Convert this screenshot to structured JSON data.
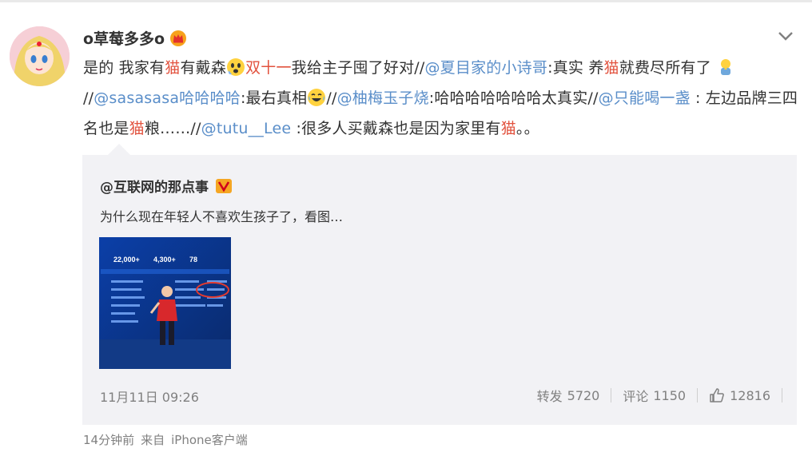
{
  "user": {
    "name": "o草莓多多o"
  },
  "post": {
    "segments": [
      {
        "t": "是的 我家有",
        "s": "text"
      },
      {
        "t": "猫",
        "s": "kw"
      },
      {
        "t": "有戴森",
        "s": "text"
      },
      {
        "t": "emoji-fear",
        "s": "emoji"
      },
      {
        "t": "双十一",
        "s": "kw"
      },
      {
        "t": "我给主子囤了好对//",
        "s": "text"
      },
      {
        "t": "@夏目家的小诗哥",
        "s": "mention"
      },
      {
        "t": ":真实 养",
        "s": "text"
      },
      {
        "t": "猫",
        "s": "kw"
      },
      {
        "t": "就费尽所有了 ",
        "s": "text"
      },
      {
        "t": "emoji-pray",
        "s": "emoji"
      },
      {
        "t": " //",
        "s": "text"
      },
      {
        "t": "@sasasasa哈哈哈哈",
        "s": "mention"
      },
      {
        "t": ":最右真相",
        "s": "text"
      },
      {
        "t": "emoji-laughcry",
        "s": "emoji"
      },
      {
        "t": "//",
        "s": "text"
      },
      {
        "t": "@柚梅玉子烧",
        "s": "mention"
      },
      {
        "t": ":哈哈哈哈哈哈哈太真实//",
        "s": "text"
      },
      {
        "t": "@只能喝一盏",
        "s": "mention"
      },
      {
        "t": " : 左边品牌三四名也是",
        "s": "text"
      },
      {
        "t": "猫",
        "s": "kw"
      },
      {
        "t": "粮……//",
        "s": "text"
      },
      {
        "t": "@tutu__Lee",
        "s": "mention"
      },
      {
        "t": " :很多人买戴森也是因为家里有",
        "s": "text"
      },
      {
        "t": "猫",
        "s": "kw"
      },
      {
        "t": "。。",
        "s": "text"
      }
    ],
    "time": "14分钟前",
    "source_prefix": "来自",
    "source": "iPhone客户端"
  },
  "original": {
    "author": "@互联网的那点事",
    "text": "为什么现在年轻人不喜欢生孩子了，看图…",
    "date": "11月11日 09:26",
    "repost_label": "转发",
    "repost_count": "5720",
    "comment_label": "评论",
    "comment_count": "1150",
    "like_count": "12816",
    "image": {
      "stat1": "22,000+",
      "stat2": "4,300+",
      "stat3": "78"
    }
  },
  "colors": {
    "mention": "#5a8ec9",
    "keyword": "#e2523e",
    "card_bg": "#f2f2f5"
  }
}
